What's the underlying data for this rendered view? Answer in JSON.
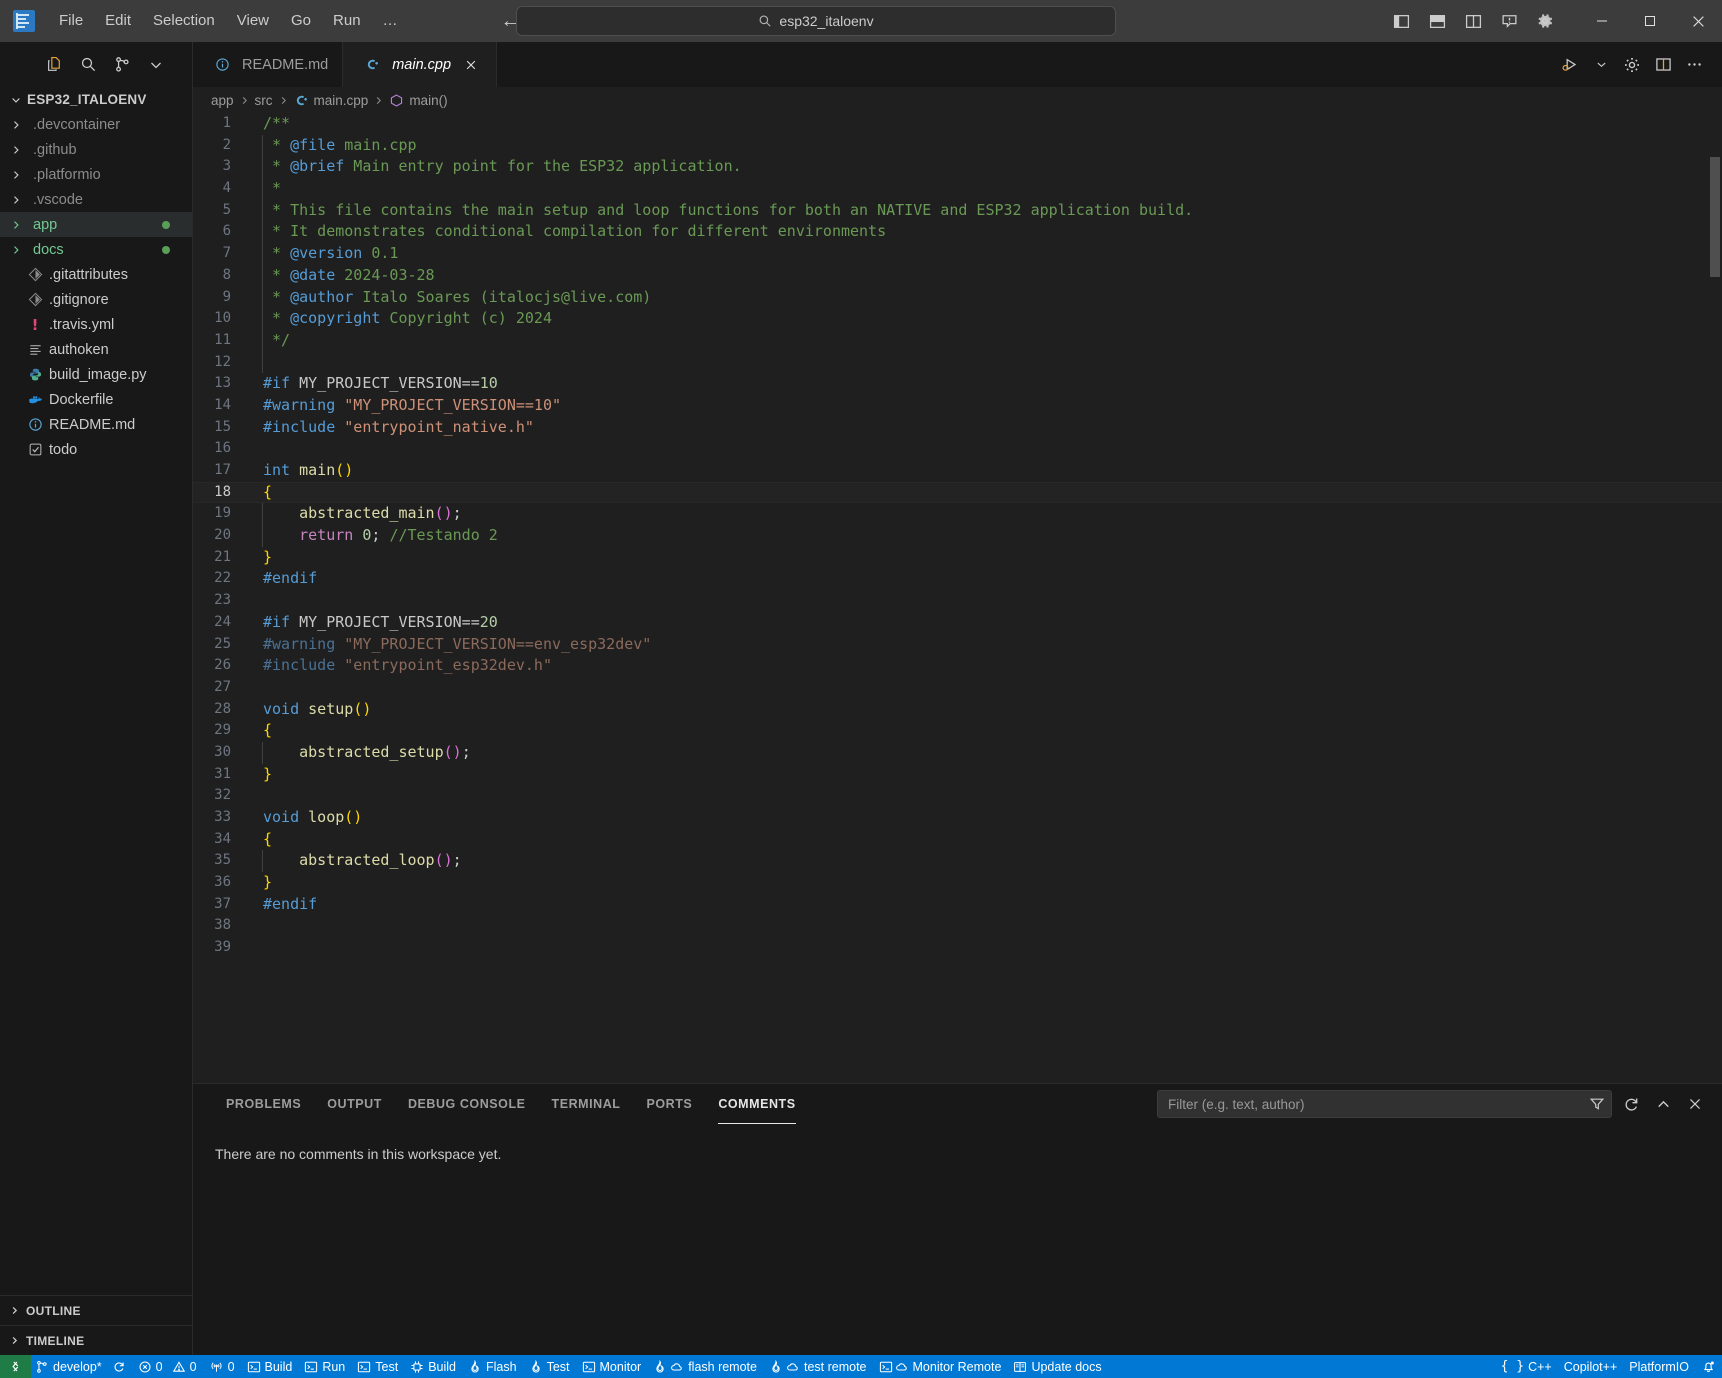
{
  "titlebar": {
    "app_logo": "vscode-logo",
    "menus": [
      "File",
      "Edit",
      "Selection",
      "View",
      "Go",
      "Run",
      "…"
    ],
    "nav_back": "back-arrow",
    "nav_forward": "forward-arrow",
    "command_center_text": "esp32_italoenv",
    "layout_buttons": [
      "toggle-primary-sidebar",
      "toggle-panel",
      "toggle-secondary-sidebar",
      "customize-layout"
    ],
    "settings_icon": "gear-icon",
    "window_controls": [
      "minimize",
      "maximize",
      "close"
    ]
  },
  "sidebar": {
    "toolbar_icons": [
      "new-file-icon",
      "search-icon",
      "source-control-icon",
      "collapse-chevron-icon"
    ],
    "root_label": "ESP32_ITALOENV",
    "items": [
      {
        "label": ".devcontainer",
        "type": "folder",
        "expanded": false,
        "state": "dim",
        "badge": false
      },
      {
        "label": ".github",
        "type": "folder",
        "expanded": false,
        "state": "dim",
        "badge": false
      },
      {
        "label": ".platformio",
        "type": "folder",
        "expanded": false,
        "state": "dim",
        "badge": false
      },
      {
        "label": ".vscode",
        "type": "folder",
        "expanded": false,
        "state": "dim",
        "badge": false
      },
      {
        "label": "app",
        "type": "folder",
        "expanded": false,
        "state": "green",
        "badge": true,
        "selected": true
      },
      {
        "label": "docs",
        "type": "folder",
        "expanded": false,
        "state": "green",
        "badge": true
      },
      {
        "label": ".gitattributes",
        "type": "file",
        "icon": "git-icon",
        "state": "normal"
      },
      {
        "label": ".gitignore",
        "type": "file",
        "icon": "git-icon",
        "state": "normal"
      },
      {
        "label": ".travis.yml",
        "type": "file",
        "icon": "travis-icon",
        "state": "normal"
      },
      {
        "label": "authoken",
        "type": "file",
        "icon": "text-file-icon",
        "state": "normal"
      },
      {
        "label": "build_image.py",
        "type": "file",
        "icon": "python-icon",
        "state": "normal"
      },
      {
        "label": "Dockerfile",
        "type": "file",
        "icon": "docker-icon",
        "state": "normal"
      },
      {
        "label": "README.md",
        "type": "file",
        "icon": "info-icon",
        "state": "normal"
      },
      {
        "label": "todo",
        "type": "file",
        "icon": "checkbox-icon",
        "state": "normal"
      }
    ],
    "sections": [
      {
        "label": "OUTLINE",
        "expanded": false
      },
      {
        "label": "TIMELINE",
        "expanded": false
      }
    ]
  },
  "editor": {
    "tabs": [
      {
        "label": "README.md",
        "icon": "info-icon",
        "active": false,
        "closable": false
      },
      {
        "label": "main.cpp",
        "icon": "cpp-icon",
        "active": true,
        "closable": true,
        "italic": true
      }
    ],
    "tab_actions": [
      "run-debug-icon",
      "chevron-down-icon",
      "gear-icon",
      "split-editor-icon",
      "more-actions-icon"
    ],
    "breadcrumb": [
      {
        "label": "app",
        "icon": null
      },
      {
        "label": "src",
        "icon": null
      },
      {
        "label": "main.cpp",
        "icon": "cpp-icon"
      },
      {
        "label": "main()",
        "icon": "symbol-method-icon"
      }
    ],
    "current_line": 18,
    "lines": [
      {
        "n": 1,
        "guide": false,
        "tokens": [
          {
            "t": "/**",
            "c": "cmt"
          }
        ]
      },
      {
        "n": 2,
        "guide": true,
        "tokens": [
          {
            "t": " * ",
            "c": "cmt"
          },
          {
            "t": "@file",
            "c": "doc"
          },
          {
            "t": " main.cpp",
            "c": "cmt"
          }
        ]
      },
      {
        "n": 3,
        "guide": true,
        "tokens": [
          {
            "t": " * ",
            "c": "cmt"
          },
          {
            "t": "@brief",
            "c": "doc"
          },
          {
            "t": " Main entry point for the ESP32 application.",
            "c": "cmt"
          }
        ]
      },
      {
        "n": 4,
        "guide": true,
        "tokens": [
          {
            "t": " *",
            "c": "cmt"
          }
        ]
      },
      {
        "n": 5,
        "guide": true,
        "tokens": [
          {
            "t": " * This file contains the main setup and loop functions for both an NATIVE and ESP32 application build.",
            "c": "cmt"
          }
        ]
      },
      {
        "n": 6,
        "guide": true,
        "tokens": [
          {
            "t": " * It demonstrates conditional compilation for different environments",
            "c": "cmt"
          }
        ]
      },
      {
        "n": 7,
        "guide": true,
        "tokens": [
          {
            "t": " * ",
            "c": "cmt"
          },
          {
            "t": "@version",
            "c": "doc"
          },
          {
            "t": " 0.1",
            "c": "cmt"
          }
        ]
      },
      {
        "n": 8,
        "guide": true,
        "tokens": [
          {
            "t": " * ",
            "c": "cmt"
          },
          {
            "t": "@date",
            "c": "doc"
          },
          {
            "t": " 2024-03-28",
            "c": "cmt"
          }
        ]
      },
      {
        "n": 9,
        "guide": true,
        "tokens": [
          {
            "t": " * ",
            "c": "cmt"
          },
          {
            "t": "@author",
            "c": "doc"
          },
          {
            "t": " Italo Soares (italocjs@live.com)",
            "c": "cmt"
          }
        ]
      },
      {
        "n": 10,
        "guide": true,
        "tokens": [
          {
            "t": " * ",
            "c": "cmt"
          },
          {
            "t": "@copyright",
            "c": "doc"
          },
          {
            "t": " Copyright (c) 2024",
            "c": "cmt"
          }
        ]
      },
      {
        "n": 11,
        "guide": true,
        "tokens": [
          {
            "t": " */",
            "c": "cmt"
          }
        ]
      },
      {
        "n": 12,
        "guide": true,
        "tokens": []
      },
      {
        "n": 13,
        "guide": false,
        "tokens": [
          {
            "t": "#if",
            "c": "pp"
          },
          {
            "t": " MY_PROJECT_VERSION==",
            "c": "macro"
          },
          {
            "t": "10",
            "c": "num"
          }
        ]
      },
      {
        "n": 14,
        "guide": false,
        "tokens": [
          {
            "t": "#warning",
            "c": "pp"
          },
          {
            "t": " ",
            "c": "plain"
          },
          {
            "t": "\"MY_PROJECT_VERSION==10\"",
            "c": "str"
          }
        ]
      },
      {
        "n": 15,
        "guide": false,
        "tokens": [
          {
            "t": "#include",
            "c": "pp"
          },
          {
            "t": " ",
            "c": "plain"
          },
          {
            "t": "\"entrypoint_native.h\"",
            "c": "str"
          }
        ]
      },
      {
        "n": 16,
        "guide": false,
        "tokens": []
      },
      {
        "n": 17,
        "guide": false,
        "tokens": [
          {
            "t": "int",
            "c": "kw"
          },
          {
            "t": " ",
            "c": "plain"
          },
          {
            "t": "main",
            "c": "fn"
          },
          {
            "t": "()",
            "c": "p1"
          }
        ]
      },
      {
        "n": 18,
        "guide": false,
        "tokens": [
          {
            "t": "{",
            "c": "p1"
          }
        ]
      },
      {
        "n": 19,
        "guide": true,
        "tokens": [
          {
            "t": "    ",
            "c": "plain"
          },
          {
            "t": "abstracted_main",
            "c": "fn"
          },
          {
            "t": "()",
            "c": "p2"
          },
          {
            "t": ";",
            "c": "plain"
          }
        ]
      },
      {
        "n": 20,
        "guide": true,
        "tokens": [
          {
            "t": "    ",
            "c": "plain"
          },
          {
            "t": "return",
            "c": "ctl"
          },
          {
            "t": " ",
            "c": "plain"
          },
          {
            "t": "0",
            "c": "num"
          },
          {
            "t": "; ",
            "c": "plain"
          },
          {
            "t": "//Testando 2",
            "c": "cmt"
          }
        ]
      },
      {
        "n": 21,
        "guide": false,
        "tokens": [
          {
            "t": "}",
            "c": "p1"
          }
        ]
      },
      {
        "n": 22,
        "guide": false,
        "tokens": [
          {
            "t": "#endif",
            "c": "pp"
          }
        ]
      },
      {
        "n": 23,
        "guide": false,
        "tokens": []
      },
      {
        "n": 24,
        "guide": false,
        "tokens": [
          {
            "t": "#if",
            "c": "pp"
          },
          {
            "t": " MY_PROJECT_VERSION==",
            "c": "macro"
          },
          {
            "t": "20",
            "c": "num"
          }
        ]
      },
      {
        "n": 25,
        "guide": false,
        "tokens": [
          {
            "t": "#warning",
            "c": "ppdim"
          },
          {
            "t": " ",
            "c": "plain"
          },
          {
            "t": "\"MY_PROJECT_VERSION==env_esp32dev\"",
            "c": "strdim"
          }
        ]
      },
      {
        "n": 26,
        "guide": false,
        "tokens": [
          {
            "t": "#include",
            "c": "ppdim"
          },
          {
            "t": " ",
            "c": "plain"
          },
          {
            "t": "\"entrypoint_esp32dev.h\"",
            "c": "strdim"
          }
        ]
      },
      {
        "n": 27,
        "guide": false,
        "tokens": []
      },
      {
        "n": 28,
        "guide": false,
        "tokens": [
          {
            "t": "void",
            "c": "kw"
          },
          {
            "t": " ",
            "c": "plain"
          },
          {
            "t": "setup",
            "c": "fn"
          },
          {
            "t": "()",
            "c": "p1"
          }
        ]
      },
      {
        "n": 29,
        "guide": false,
        "tokens": [
          {
            "t": "{",
            "c": "p1"
          }
        ]
      },
      {
        "n": 30,
        "guide": true,
        "tokens": [
          {
            "t": "    ",
            "c": "plain"
          },
          {
            "t": "abstracted_setup",
            "c": "fn"
          },
          {
            "t": "()",
            "c": "p2"
          },
          {
            "t": ";",
            "c": "plain"
          }
        ]
      },
      {
        "n": 31,
        "guide": false,
        "tokens": [
          {
            "t": "}",
            "c": "p1"
          }
        ]
      },
      {
        "n": 32,
        "guide": false,
        "tokens": []
      },
      {
        "n": 33,
        "guide": false,
        "tokens": [
          {
            "t": "void",
            "c": "kw"
          },
          {
            "t": " ",
            "c": "plain"
          },
          {
            "t": "loop",
            "c": "fn"
          },
          {
            "t": "()",
            "c": "p1"
          }
        ]
      },
      {
        "n": 34,
        "guide": false,
        "tokens": [
          {
            "t": "{",
            "c": "p1"
          }
        ]
      },
      {
        "n": 35,
        "guide": true,
        "tokens": [
          {
            "t": "    ",
            "c": "plain"
          },
          {
            "t": "abstracted_loop",
            "c": "fn"
          },
          {
            "t": "()",
            "c": "p2"
          },
          {
            "t": ";",
            "c": "plain"
          }
        ]
      },
      {
        "n": 36,
        "guide": false,
        "tokens": [
          {
            "t": "}",
            "c": "p1"
          }
        ]
      },
      {
        "n": 37,
        "guide": false,
        "tokens": [
          {
            "t": "#endif",
            "c": "pp"
          }
        ]
      },
      {
        "n": 38,
        "guide": false,
        "tokens": []
      },
      {
        "n": 39,
        "guide": false,
        "tokens": []
      }
    ]
  },
  "panel": {
    "tabs": [
      {
        "label": "PROBLEMS",
        "active": false
      },
      {
        "label": "OUTPUT",
        "active": false
      },
      {
        "label": "DEBUG CONSOLE",
        "active": false
      },
      {
        "label": "TERMINAL",
        "active": false
      },
      {
        "label": "PORTS",
        "active": false
      },
      {
        "label": "COMMENTS",
        "active": true
      }
    ],
    "filter_placeholder": "Filter (e.g. text, author)",
    "filter_value": "",
    "filter_icon": "funnel-icon",
    "actions": [
      "refresh-icon",
      "collapse-chevron-up-icon",
      "close-icon"
    ],
    "empty_message": "There are no comments in this workspace yet."
  },
  "statusbar": {
    "remote_icon": "remote-window-icon",
    "branch": "develop*",
    "sync_icon": "sync-icon",
    "errors": "0",
    "warnings": "0",
    "radio_count": "0",
    "items": [
      {
        "label": "Build",
        "icon": "terminal-icon"
      },
      {
        "label": "Run",
        "icon": "terminal-icon"
      },
      {
        "label": "Test",
        "icon": "terminal-icon"
      },
      {
        "label": "Build",
        "icon": "chip-icon"
      },
      {
        "label": "Flash",
        "icon": "flame-icon"
      },
      {
        "label": "Test",
        "icon": "flame-icon"
      },
      {
        "label": "Monitor",
        "icon": "terminal-icon"
      },
      {
        "label": "flash remote",
        "icon": "flame-cloud-icon"
      },
      {
        "label": "test remote",
        "icon": "flame-cloud-icon"
      },
      {
        "label": "Monitor Remote",
        "icon": "terminal-cloud-icon"
      },
      {
        "label": "Update docs",
        "icon": "book-icon"
      }
    ],
    "right_items": [
      {
        "label": "C++",
        "icon": "braces-icon"
      },
      {
        "label": "Copilot++",
        "icon": null
      },
      {
        "label": "PlatformIO",
        "icon": null
      }
    ],
    "bell_icon": "bell-dot-icon",
    "accent_color": "#0078d4",
    "remote_color": "#1f7c46"
  }
}
